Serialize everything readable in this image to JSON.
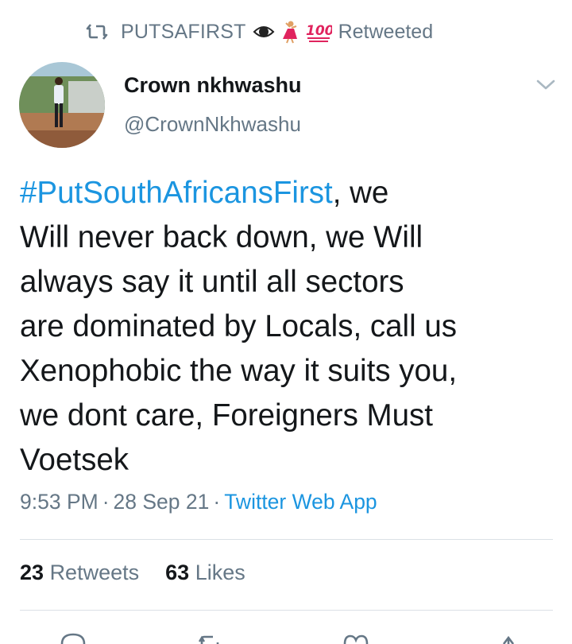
{
  "social_context": {
    "retweeter_name": "PUTSAFIRST",
    "suffix": "Retweeted",
    "icons": [
      "retweet-icon",
      "eye-emoji",
      "dancer-emoji",
      "hundred-points-emoji"
    ]
  },
  "author": {
    "display_name": "Crown nkhwashu",
    "handle": "@CrownNkhwashu",
    "avatar": "profile-photo"
  },
  "tweet": {
    "hashtag": "#PutSouthAfricansFirst",
    "line1_rest": ", we",
    "line2": "Will never back down, we Will",
    "line3": "always say it until all sectors",
    "line4": "are dominated by Locals, call us",
    "line5": "Xenophobic the way it suits you,",
    "line6": "we dont care, Foreigners Must",
    "line7": "Voetsek"
  },
  "meta": {
    "time": "9:53 PM",
    "separator": "·",
    "date": "28 Sep 21",
    "source": "Twitter Web App"
  },
  "stats": {
    "retweets_count": "23",
    "retweets_label": "Retweets",
    "likes_count": "63",
    "likes_label": "Likes"
  },
  "colors": {
    "link": "#1b95e0",
    "secondary_text": "#657786",
    "primary_text": "#14171a",
    "divider": "#dbe1e6"
  }
}
